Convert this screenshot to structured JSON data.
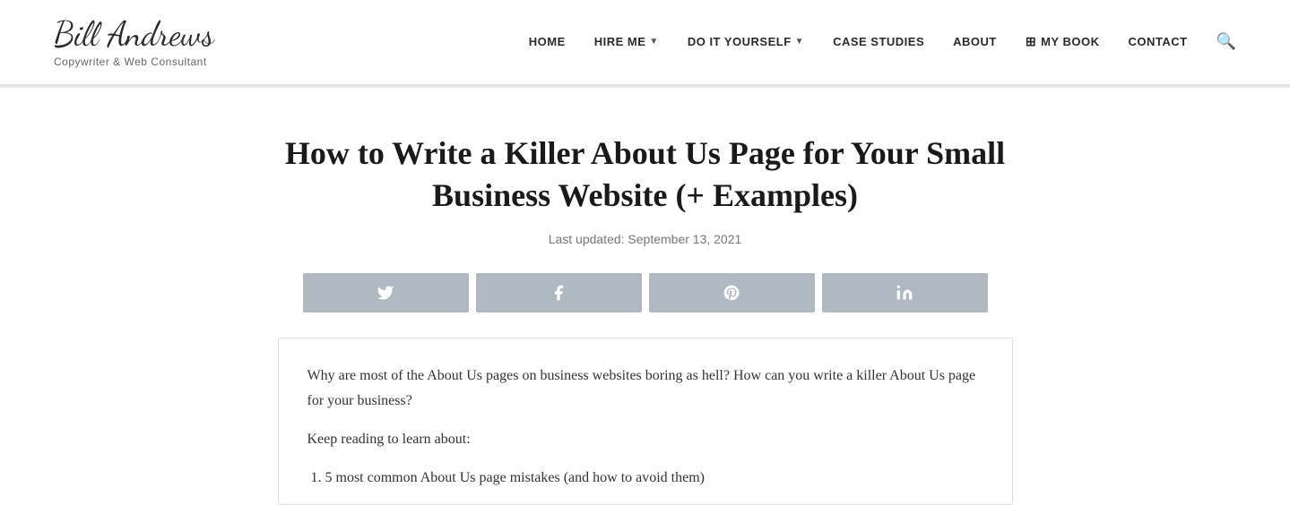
{
  "header": {
    "logo_name": "Bill Andrews",
    "logo_tagline": "Copywriter & Web Consultant",
    "nav": {
      "items": [
        {
          "label": "HOME",
          "has_arrow": false
        },
        {
          "label": "HIRE ME",
          "has_arrow": true
        },
        {
          "label": "DO IT YOURSELF",
          "has_arrow": true
        },
        {
          "label": "CASE STUDIES",
          "has_arrow": false
        },
        {
          "label": "ABOUT",
          "has_arrow": false
        },
        {
          "label": "MY BOOK",
          "has_arrow": false,
          "has_icon": true
        },
        {
          "label": "CONTACT",
          "has_arrow": false
        }
      ]
    }
  },
  "article": {
    "title": "How to Write a Killer About Us Page for Your Small Business Website (+ Examples)",
    "date_label": "Last updated: September 13, 2021",
    "share_buttons": [
      {
        "icon": "🐦",
        "label": "twitter"
      },
      {
        "icon": "f",
        "label": "facebook"
      },
      {
        "icon": "P",
        "label": "pinterest"
      },
      {
        "icon": "in",
        "label": "linkedin"
      }
    ],
    "content_intro": "Why are most of the About Us pages on business websites boring as hell? How can you write a killer About Us page for your business?",
    "content_keep_reading": "Keep reading to learn about:",
    "content_list": [
      "5 most common About Us page mistakes (and how to avoid them)"
    ]
  }
}
